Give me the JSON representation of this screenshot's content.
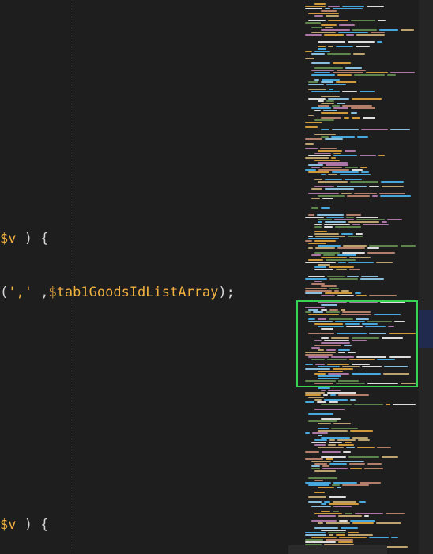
{
  "editor": {
    "lines": [
      {
        "id": "line1",
        "tokens": [
          {
            "text": "$v",
            "kind": "var"
          },
          {
            "text": ") {",
            "kind": "punc"
          }
        ]
      },
      {
        "id": "line2",
        "tokens": [
          {
            "text": "(",
            "kind": "punc"
          },
          {
            "text": "','",
            "kind": "str"
          },
          {
            "text": " ,",
            "kind": "punc"
          },
          {
            "text": "$tab1GoodsIdListArray",
            "kind": "var"
          },
          {
            "text": ");",
            "kind": "punc"
          }
        ]
      },
      {
        "id": "line3",
        "tokens": [
          {
            "text": "$v",
            "kind": "var"
          },
          {
            "text": ") {",
            "kind": "punc"
          }
        ]
      }
    ]
  },
  "colors": {
    "background": "#1e1e1e",
    "variable": "#f0b040",
    "string": "#f0b040",
    "punctuation": "#d4d4d4",
    "minimap_highlight": "#39d353",
    "scrollbar_thumb": "#1f2a4e"
  }
}
